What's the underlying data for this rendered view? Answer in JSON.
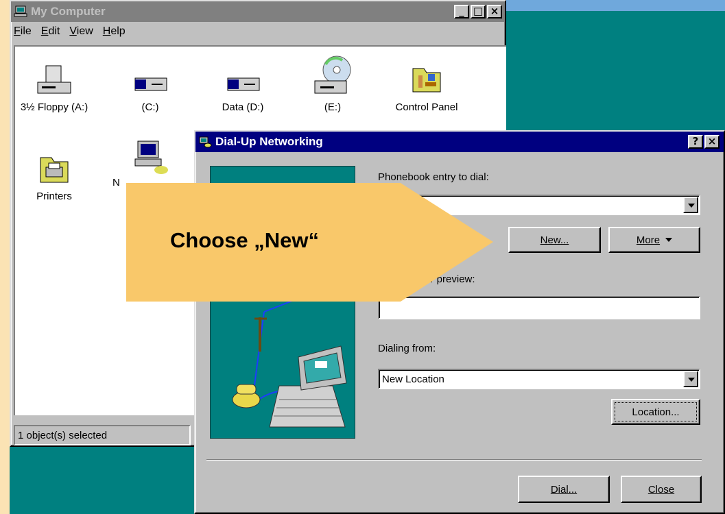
{
  "my_computer": {
    "title": "My Computer",
    "menu": [
      "File",
      "Edit",
      "View",
      "Help"
    ],
    "icons": [
      {
        "label": "3½ Floppy (A:)",
        "icon": "floppy-drive-icon"
      },
      {
        "label": "(C:)",
        "icon": "hard-drive-icon"
      },
      {
        "label": "Data (D:)",
        "icon": "hard-drive-icon"
      },
      {
        "label": "(E:)",
        "icon": "cd-drive-icon"
      },
      {
        "label": "Control Panel",
        "icon": "control-panel-icon"
      },
      {
        "label": "Printers",
        "icon": "printers-folder-icon"
      },
      {
        "label": "N",
        "icon": "dialup-networking-icon"
      }
    ],
    "status": "1 object(s) selected"
  },
  "dialup": {
    "title": "Dial-Up Networking",
    "phonebook_label": "Phonebook entry to dial:",
    "phonebook_value": "",
    "new_button": "New...",
    "more_button": "More",
    "number_preview_label": "umber preview:",
    "number_preview_value": "",
    "dialing_from_label": "Dialing from:",
    "dialing_from_value": "New Location",
    "location_button": "Location...",
    "dial_button": "Dial...",
    "close_button": "Close"
  },
  "callout": {
    "text": "Choose „New“"
  },
  "colors": {
    "desktop": "#008080",
    "callout": "#f9c86a",
    "active_title": "#000080",
    "inactive_title": "#808080",
    "slide_background": "#fbe3b4"
  }
}
